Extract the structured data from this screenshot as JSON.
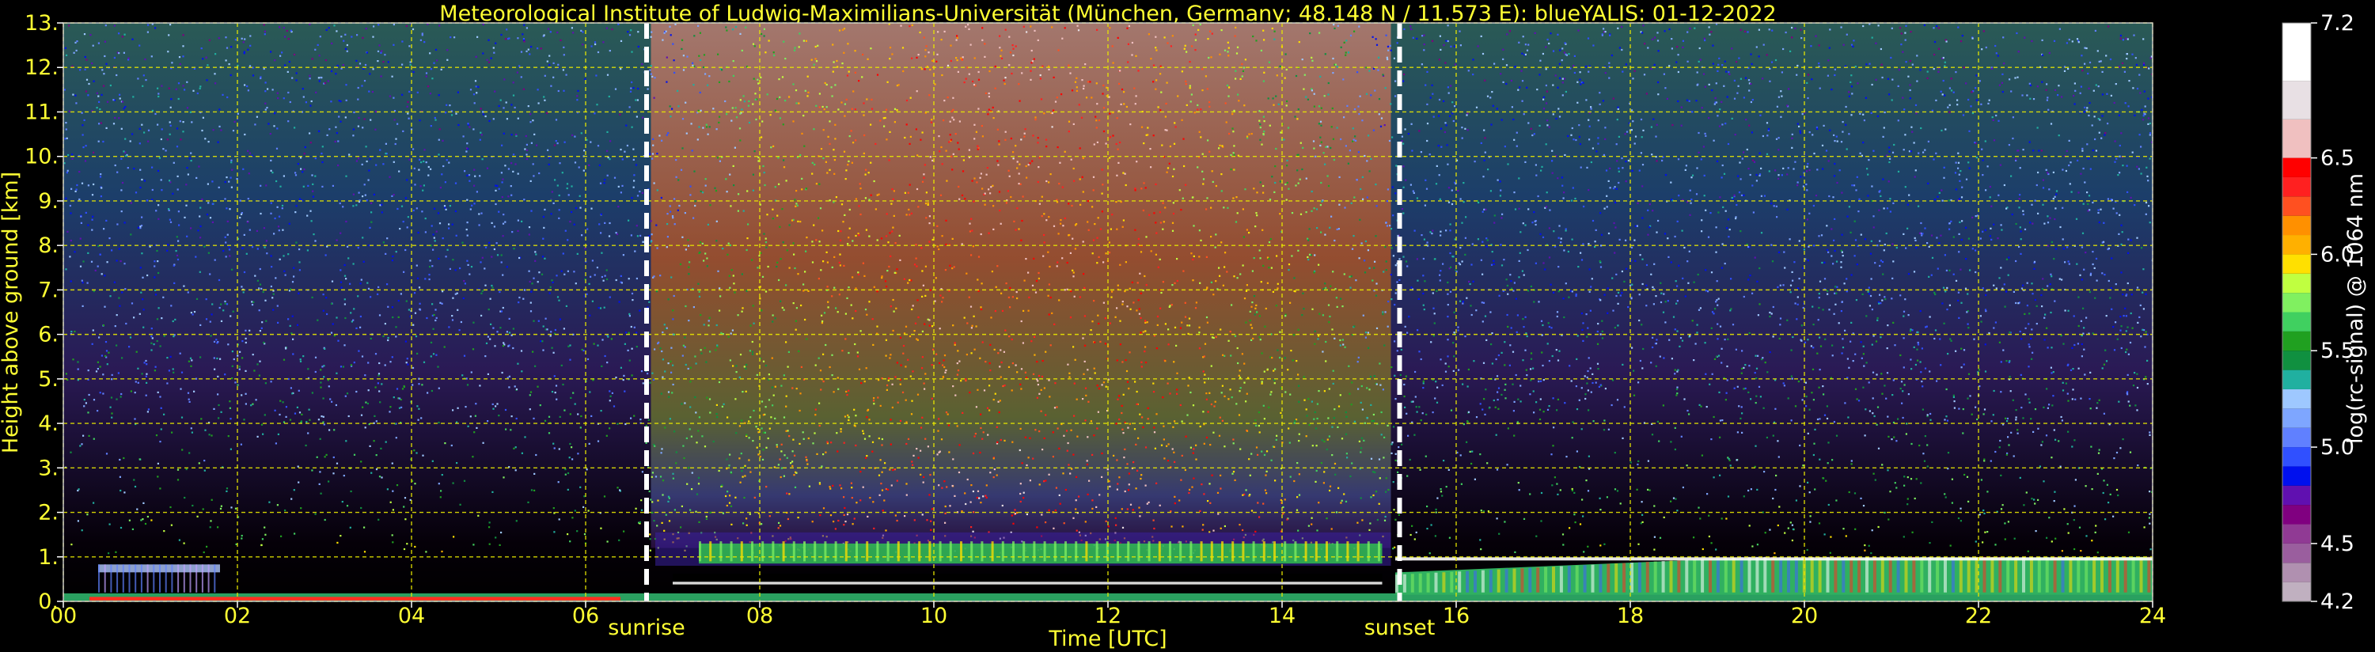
{
  "chart_data": {
    "type": "heatmap",
    "title": "Meteorological Institute of Ludwig-Maximilians-Universität (München, Germany; 48.148 N / 11.573 E):     blueYALIS: 01-12-2022",
    "xlabel": "Time [UTC]",
    "ylabel": "Height above ground [km]",
    "xlim": [
      0,
      24
    ],
    "ylim": [
      0,
      13
    ],
    "x_ticks": [
      0,
      2,
      4,
      6,
      8,
      10,
      12,
      14,
      16,
      18,
      20,
      22,
      24
    ],
    "x_tick_labels": [
      "00",
      "02",
      "04",
      "06",
      "08",
      "10",
      "12",
      "14",
      "16",
      "18",
      "20",
      "22",
      "24"
    ],
    "y_ticks": [
      0,
      1,
      2,
      3,
      4,
      5,
      6,
      7,
      8,
      9,
      10,
      11,
      12,
      13
    ],
    "y_tick_labels": [
      "0.",
      "1.",
      "2.",
      "3.",
      "4.",
      "5.",
      "6.",
      "7.",
      "8.",
      "9.",
      "10.",
      "11.",
      "12.",
      "13."
    ],
    "grid": true,
    "grid_color": "#e8e800",
    "text_color": "#ffff33",
    "events": [
      {
        "label": "sunrise",
        "time": 6.7
      },
      {
        "label": "sunset",
        "time": 15.35
      }
    ],
    "colorbar": {
      "label": "log(rc-signal) @ 1064 nm",
      "range": [
        4.2,
        7.2
      ],
      "tick_labels": [
        "4.2",
        "4.5",
        "5.0",
        "5.5",
        "6.0",
        "6.5",
        "7.2"
      ],
      "ticks": [
        4.2,
        4.5,
        5.0,
        5.5,
        6.0,
        6.5,
        7.2
      ],
      "levels": [
        {
          "from": 4.2,
          "to": 4.3,
          "color": "#c0b0c0"
        },
        {
          "from": 4.3,
          "to": 4.4,
          "color": "#b090b0"
        },
        {
          "from": 4.4,
          "to": 4.5,
          "color": "#9a5e9e"
        },
        {
          "from": 4.5,
          "to": 4.6,
          "color": "#903a94"
        },
        {
          "from": 4.6,
          "to": 4.7,
          "color": "#800080"
        },
        {
          "from": 4.7,
          "to": 4.8,
          "color": "#6010b0"
        },
        {
          "from": 4.8,
          "to": 4.9,
          "color": "#0010ee"
        },
        {
          "from": 4.9,
          "to": 5.0,
          "color": "#3050ff"
        },
        {
          "from": 5.0,
          "to": 5.1,
          "color": "#6080ff"
        },
        {
          "from": 5.1,
          "to": 5.2,
          "color": "#7ea6ff"
        },
        {
          "from": 5.2,
          "to": 5.3,
          "color": "#9ec8ff"
        },
        {
          "from": 5.3,
          "to": 5.4,
          "color": "#20b0a0"
        },
        {
          "from": 5.4,
          "to": 5.5,
          "color": "#109040"
        },
        {
          "from": 5.5,
          "to": 5.6,
          "color": "#20a020"
        },
        {
          "from": 5.6,
          "to": 5.7,
          "color": "#40d060"
        },
        {
          "from": 5.7,
          "to": 5.8,
          "color": "#80f060"
        },
        {
          "from": 5.8,
          "to": 5.9,
          "color": "#c0ff40"
        },
        {
          "from": 5.9,
          "to": 6.0,
          "color": "#ffe000"
        },
        {
          "from": 6.0,
          "to": 6.1,
          "color": "#ffb000"
        },
        {
          "from": 6.1,
          "to": 6.2,
          "color": "#ff9000"
        },
        {
          "from": 6.2,
          "to": 6.3,
          "color": "#ff5020"
        },
        {
          "from": 6.3,
          "to": 6.4,
          "color": "#ff2020"
        },
        {
          "from": 6.4,
          "to": 6.5,
          "color": "#ff0000"
        },
        {
          "from": 6.5,
          "to": 6.7,
          "color": "#f0c0c0"
        },
        {
          "from": 6.7,
          "to": 6.9,
          "color": "#e8e0e4"
        },
        {
          "from": 6.9,
          "to": 7.2,
          "color": "#ffffff"
        }
      ]
    },
    "features": [
      {
        "name": "boundary layer top (night)",
        "t_start": 0.0,
        "t_end": 1.8,
        "height_km": 0.75
      },
      {
        "name": "boundary layer (day)",
        "t_start": 7.0,
        "t_end": 15.3,
        "height_km": 0.9
      },
      {
        "name": "boundary layer (evening)",
        "t_start": 15.3,
        "t_end": 24.0,
        "height_km": 0.95
      }
    ]
  }
}
